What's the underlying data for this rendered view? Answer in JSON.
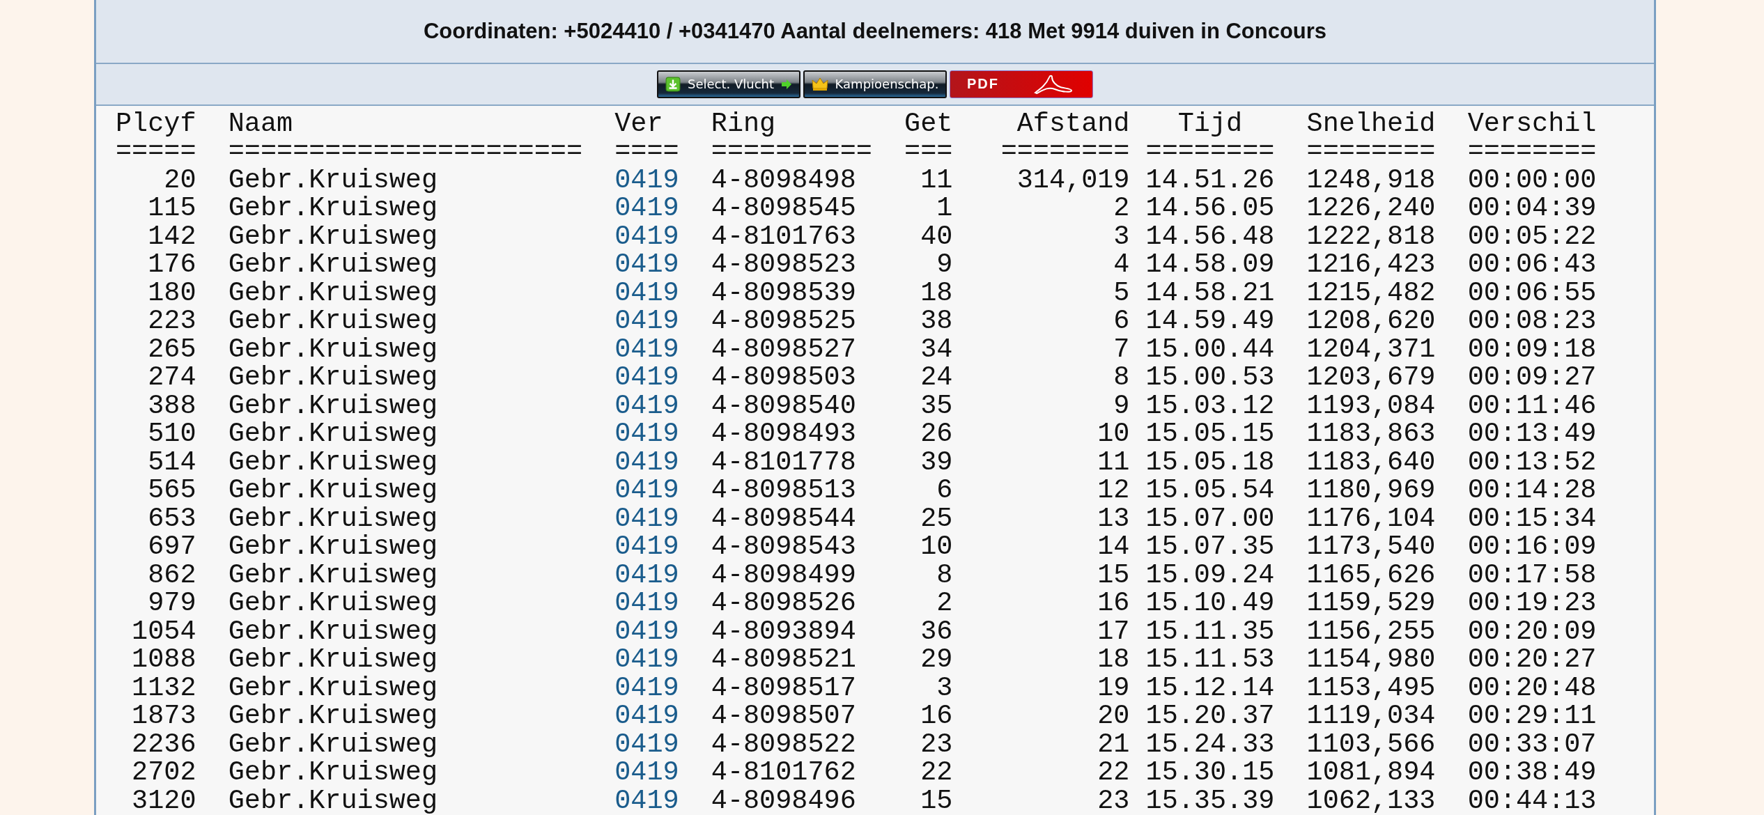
{
  "header": {
    "title": "Coordinaten: +5024410 / +0341470 Aantal deelnemers: 418 Met 9914 duiven in Concours"
  },
  "buttons": [
    {
      "kind": "select",
      "label": "Select. Vlucht"
    },
    {
      "kind": "champion",
      "label": "Kampioenschap."
    },
    {
      "kind": "pdf",
      "label": "PDF"
    }
  ],
  "table": {
    "columns": [
      {
        "label": "Plcyf",
        "underline": "====="
      },
      {
        "label": "Naam",
        "underline": "======================"
      },
      {
        "label": "Ver",
        "underline": "===="
      },
      {
        "label": "Ring",
        "underline": "=========="
      },
      {
        "label": "Get",
        "underline": "==="
      },
      {
        "label": "Afstand",
        "underline": "========"
      },
      {
        "label": "Tijd",
        "underline": "========"
      },
      {
        "label": "Snelheid",
        "underline": "========"
      },
      {
        "label": "Verschil",
        "underline": "========"
      }
    ],
    "rows": [
      [
        "20",
        "Gebr.Kruisweg",
        "0419",
        "4-8098498",
        "11",
        "314,019",
        "14.51.26",
        "1248,918",
        "00:00:00"
      ],
      [
        "115",
        "Gebr.Kruisweg",
        "0419",
        "4-8098545",
        "1",
        "2",
        "14.56.05",
        "1226,240",
        "00:04:39"
      ],
      [
        "142",
        "Gebr.Kruisweg",
        "0419",
        "4-8101763",
        "40",
        "3",
        "14.56.48",
        "1222,818",
        "00:05:22"
      ],
      [
        "176",
        "Gebr.Kruisweg",
        "0419",
        "4-8098523",
        "9",
        "4",
        "14.58.09",
        "1216,423",
        "00:06:43"
      ],
      [
        "180",
        "Gebr.Kruisweg",
        "0419",
        "4-8098539",
        "18",
        "5",
        "14.58.21",
        "1215,482",
        "00:06:55"
      ],
      [
        "223",
        "Gebr.Kruisweg",
        "0419",
        "4-8098525",
        "38",
        "6",
        "14.59.49",
        "1208,620",
        "00:08:23"
      ],
      [
        "265",
        "Gebr.Kruisweg",
        "0419",
        "4-8098527",
        "34",
        "7",
        "15.00.44",
        "1204,371",
        "00:09:18"
      ],
      [
        "274",
        "Gebr.Kruisweg",
        "0419",
        "4-8098503",
        "24",
        "8",
        "15.00.53",
        "1203,679",
        "00:09:27"
      ],
      [
        "388",
        "Gebr.Kruisweg",
        "0419",
        "4-8098540",
        "35",
        "9",
        "15.03.12",
        "1193,084",
        "00:11:46"
      ],
      [
        "510",
        "Gebr.Kruisweg",
        "0419",
        "4-8098493",
        "26",
        "10",
        "15.05.15",
        "1183,863",
        "00:13:49"
      ],
      [
        "514",
        "Gebr.Kruisweg",
        "0419",
        "4-8101778",
        "39",
        "11",
        "15.05.18",
        "1183,640",
        "00:13:52"
      ],
      [
        "565",
        "Gebr.Kruisweg",
        "0419",
        "4-8098513",
        "6",
        "12",
        "15.05.54",
        "1180,969",
        "00:14:28"
      ],
      [
        "653",
        "Gebr.Kruisweg",
        "0419",
        "4-8098544",
        "25",
        "13",
        "15.07.00",
        "1176,104",
        "00:15:34"
      ],
      [
        "697",
        "Gebr.Kruisweg",
        "0419",
        "4-8098543",
        "10",
        "14",
        "15.07.35",
        "1173,540",
        "00:16:09"
      ],
      [
        "862",
        "Gebr.Kruisweg",
        "0419",
        "4-8098499",
        "8",
        "15",
        "15.09.24",
        "1165,626",
        "00:17:58"
      ],
      [
        "979",
        "Gebr.Kruisweg",
        "0419",
        "4-8098526",
        "2",
        "16",
        "15.10.49",
        "1159,529",
        "00:19:23"
      ],
      [
        "1054",
        "Gebr.Kruisweg",
        "0419",
        "4-8093894",
        "36",
        "17",
        "15.11.35",
        "1156,255",
        "00:20:09"
      ],
      [
        "1088",
        "Gebr.Kruisweg",
        "0419",
        "4-8098521",
        "29",
        "18",
        "15.11.53",
        "1154,980",
        "00:20:27"
      ],
      [
        "1132",
        "Gebr.Kruisweg",
        "0419",
        "4-8098517",
        "3",
        "19",
        "15.12.14",
        "1153,495",
        "00:20:48"
      ],
      [
        "1873",
        "Gebr.Kruisweg",
        "0419",
        "4-8098507",
        "16",
        "20",
        "15.20.37",
        "1119,034",
        "00:29:11"
      ],
      [
        "2236",
        "Gebr.Kruisweg",
        "0419",
        "4-8098522",
        "23",
        "21",
        "15.24.33",
        "1103,566",
        "00:33:07"
      ],
      [
        "2702",
        "Gebr.Kruisweg",
        "0419",
        "4-8101762",
        "22",
        "22",
        "15.30.15",
        "1081,894",
        "00:38:49"
      ],
      [
        "3120",
        "Gebr.Kruisweg",
        "0419",
        "4-8098496",
        "15",
        "23",
        "15.35.39",
        "1062,133",
        "00:44:13"
      ]
    ]
  }
}
